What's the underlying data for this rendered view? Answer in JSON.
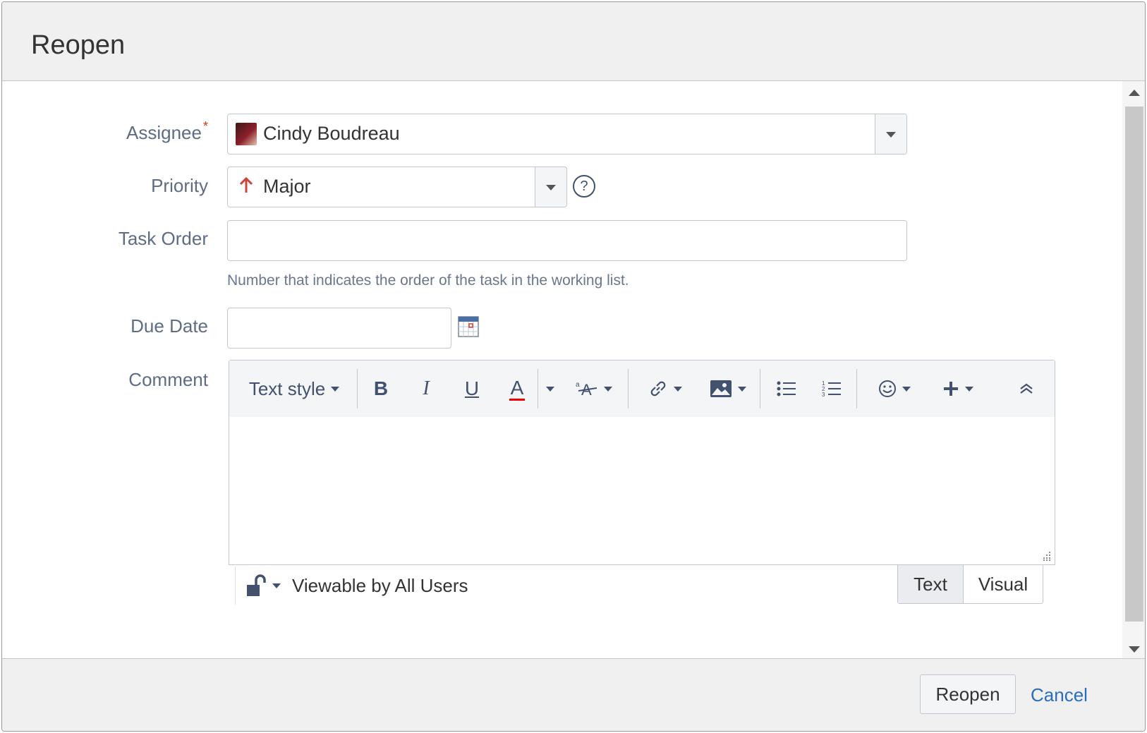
{
  "dialog": {
    "title": "Reopen"
  },
  "form": {
    "assignee": {
      "label": "Assignee",
      "required_mark": "*",
      "value": "Cindy Boudreau"
    },
    "priority": {
      "label": "Priority",
      "value": "Major",
      "help": "?"
    },
    "task_order": {
      "label": "Task Order",
      "value": "",
      "hint": "Number that indicates the order of the task in the working list."
    },
    "due_date": {
      "label": "Due Date",
      "value": ""
    },
    "comment": {
      "label": "Comment"
    }
  },
  "editor": {
    "text_style": "Text style",
    "bold": "B",
    "italic": "I",
    "underline": "U",
    "color": "A",
    "visibility": "Viewable by All Users",
    "tabs": [
      "Text",
      "Visual"
    ]
  },
  "footer": {
    "submit_label": "Reopen",
    "cancel_label": "Cancel"
  },
  "colors": {
    "priority_major": "#d04437",
    "link": "#2a6ebb",
    "required": "#de350b"
  }
}
